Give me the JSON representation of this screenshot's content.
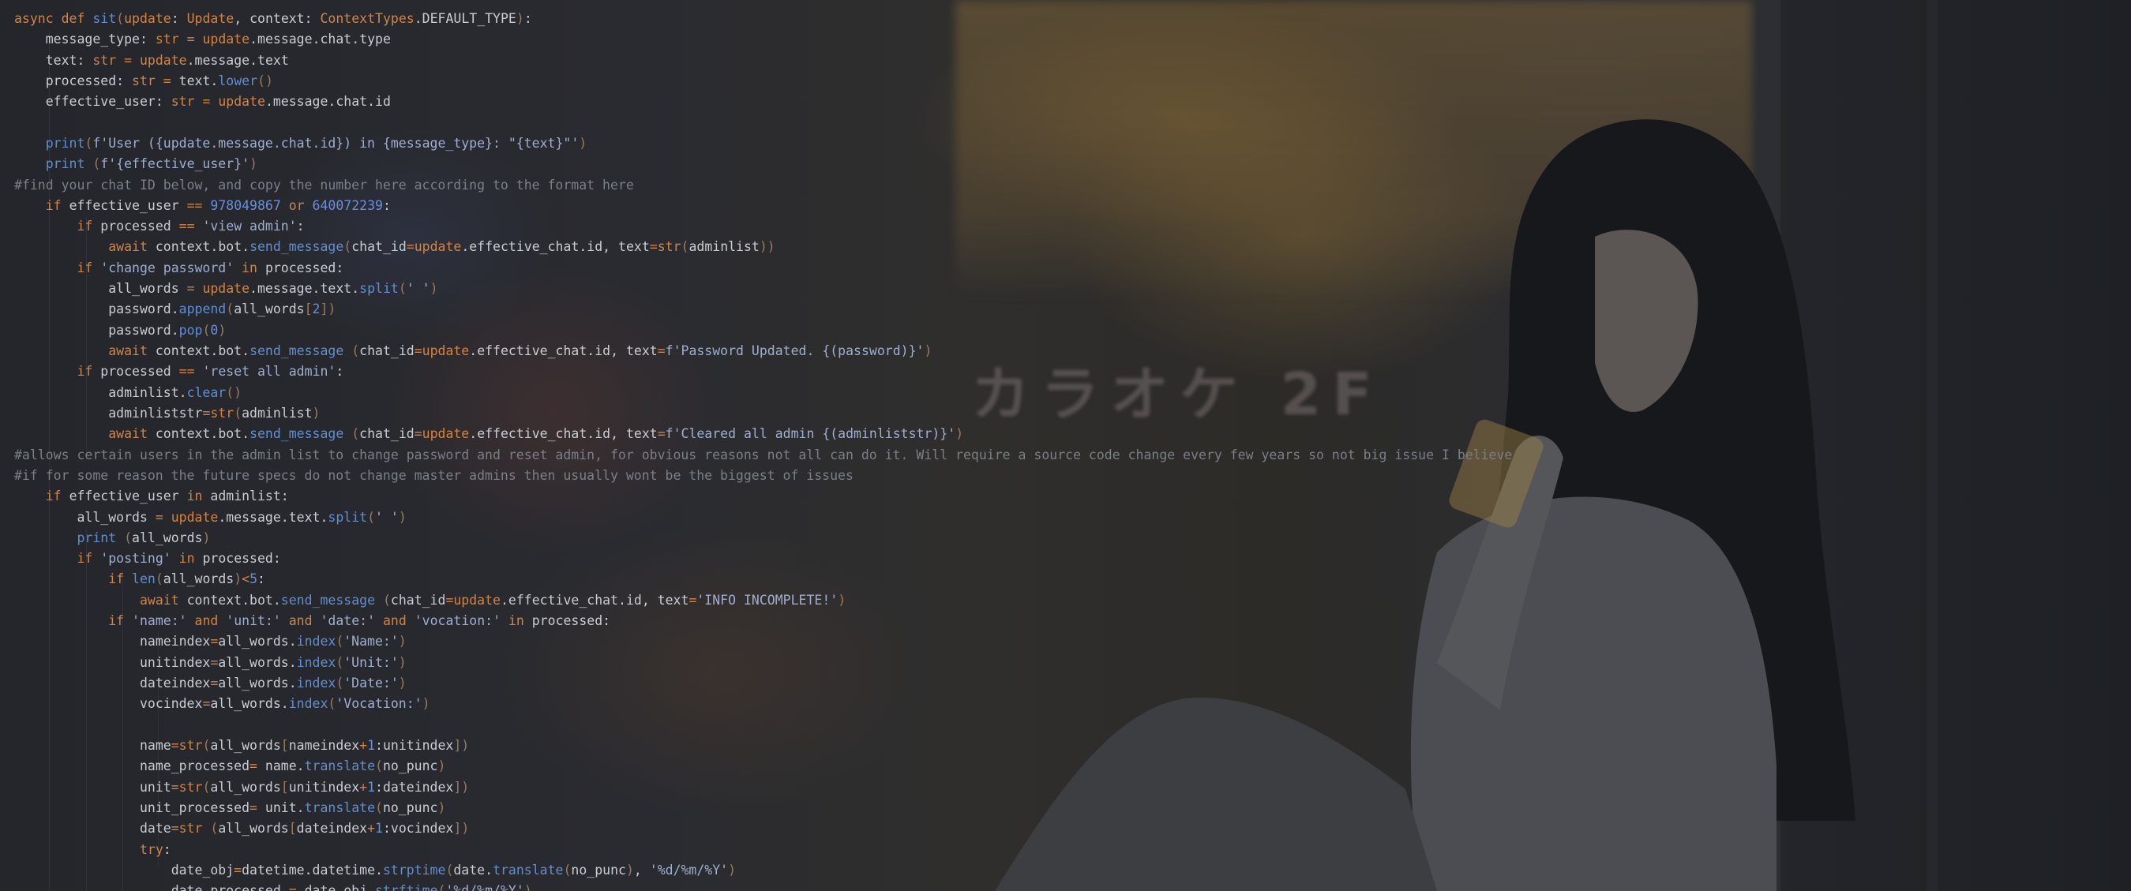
{
  "editor": {
    "language": "python",
    "lines": [
      "async def sit(update: Update, context: ContextTypes.DEFAULT_TYPE):",
      "    message_type: str = update.message.chat.type",
      "    text: str = update.message.text",
      "    processed: str = text.lower()",
      "    effective_user: str = update.message.chat.id",
      "",
      "    print(f'User ({update.message.chat.id}) in {message_type}: \"{text}\"')",
      "    print (f'{effective_user}')",
      "#find your chat ID below, and copy the number here according to the format here",
      "    if effective_user == 978049867 or 640072239:",
      "        if processed == 'view admin':",
      "            await context.bot.send_message(chat_id=update.effective_chat.id, text=str(adminlist))",
      "        if 'change password' in processed:",
      "            all_words = update.message.text.split(' ')",
      "            password.append(all_words[2])",
      "            password.pop(0)",
      "            await context.bot.send_message (chat_id=update.effective_chat.id, text=f'Password Updated. {(password)}')",
      "        if processed == 'reset all admin':",
      "            adminlist.clear()",
      "            adminliststr=str(adminlist)",
      "            await context.bot.send_message (chat_id=update.effective_chat.id, text=f'Cleared all admin {(adminliststr)}')",
      "#allows certain users in the admin list to change password and reset admin, for obvious reasons not all can do it. Will require a source code change every few years so not big issue I believe",
      "#if for some reason the future specs do not change master admins then usually wont be the biggest of issues",
      "    if effective_user in adminlist:",
      "        all_words = update.message.text.split(' ')",
      "        print (all_words)",
      "        if 'posting' in processed:",
      "            if len(all_words)<5:",
      "                await context.bot.send_message (chat_id=update.effective_chat.id, text='INFO INCOMPLETE!')",
      "            if 'name:' and 'unit:' and 'date:' and 'vocation:' in processed:",
      "                nameindex=all_words.index('Name:')",
      "                unitindex=all_words.index('Unit:')",
      "                dateindex=all_words.index('Date:')",
      "                vocindex=all_words.index('Vocation:')",
      "",
      "                name=str(all_words[nameindex+1:unitindex])",
      "                name_processed= name.translate(no_punc)",
      "                unit=str(all_words[unitindex+1:dateindex])",
      "                unit_processed= unit.translate(no_punc)",
      "                date=str (all_words[dateindex+1:vocindex])",
      "                try:",
      "                    date_obj=datetime.datetime.strptime(date.translate(no_punc), '%d/%m/%Y')",
      "                    date_processed = date_obj.strftime('%d/%m/%Y')"
    ]
  },
  "wallpaper": {
    "sign_text": "カラオケ 2F",
    "accent_colors": {
      "keyword": "#d28445",
      "function": "#5f8fd0",
      "string": "#9faed0",
      "number": "#6a8fd8",
      "comment": "#7a7f88",
      "text": "#c9cdd3"
    }
  }
}
